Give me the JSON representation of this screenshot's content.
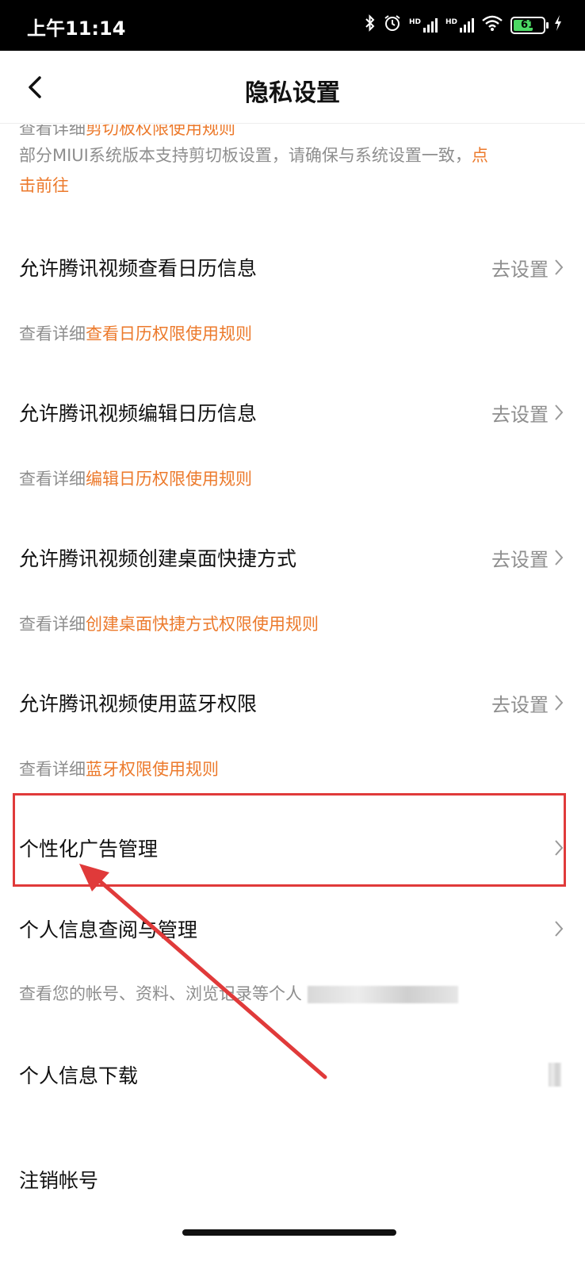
{
  "status_bar": {
    "time": "上午11:14",
    "battery": "61",
    "icons": [
      "bluetooth-icon",
      "alarm-icon",
      "hd-signal-icon",
      "hd-signal-icon",
      "wifi-icon",
      "battery-icon",
      "charging-icon"
    ],
    "hd_label": "HD"
  },
  "header": {
    "title": "隐私设置"
  },
  "clipboard": {
    "line1_prefix": "查看详细",
    "line1_link": "剪切板权限使用规则",
    "line2_text": "部分MIUI系统版本支持剪切板设置，请确保与系统设置一致，",
    "line2_link_a": "点",
    "line3_link_b": "击前往"
  },
  "settings": [
    {
      "label": "允许腾讯视频查看日历信息",
      "action": "去设置",
      "desc_prefix": "查看详细",
      "desc_link": "查看日历权限使用规则"
    },
    {
      "label": "允许腾讯视频编辑日历信息",
      "action": "去设置",
      "desc_prefix": "查看详细",
      "desc_link": "编辑日历权限使用规则"
    },
    {
      "label": "允许腾讯视频创建桌面快捷方式",
      "action": "去设置",
      "desc_prefix": "查看详细",
      "desc_link": "创建桌面快捷方式权限使用规则"
    },
    {
      "label": "允许腾讯视频使用蓝牙权限",
      "action": "去设置",
      "desc_prefix": "查看详细",
      "desc_link": "蓝牙权限使用规则"
    }
  ],
  "personalized_ads": {
    "label": "个性化广告管理"
  },
  "personal_info": {
    "label": "个人信息查阅与管理",
    "desc": "查看您的帐号、资料、浏览记录等个人"
  },
  "download": {
    "label": "个人信息下载"
  },
  "cancel": {
    "label": "注销帐号"
  },
  "colors": {
    "accent_link": "#ec7a2c",
    "annotation_red": "#e03a3a",
    "muted_text": "#8e8e8e"
  }
}
